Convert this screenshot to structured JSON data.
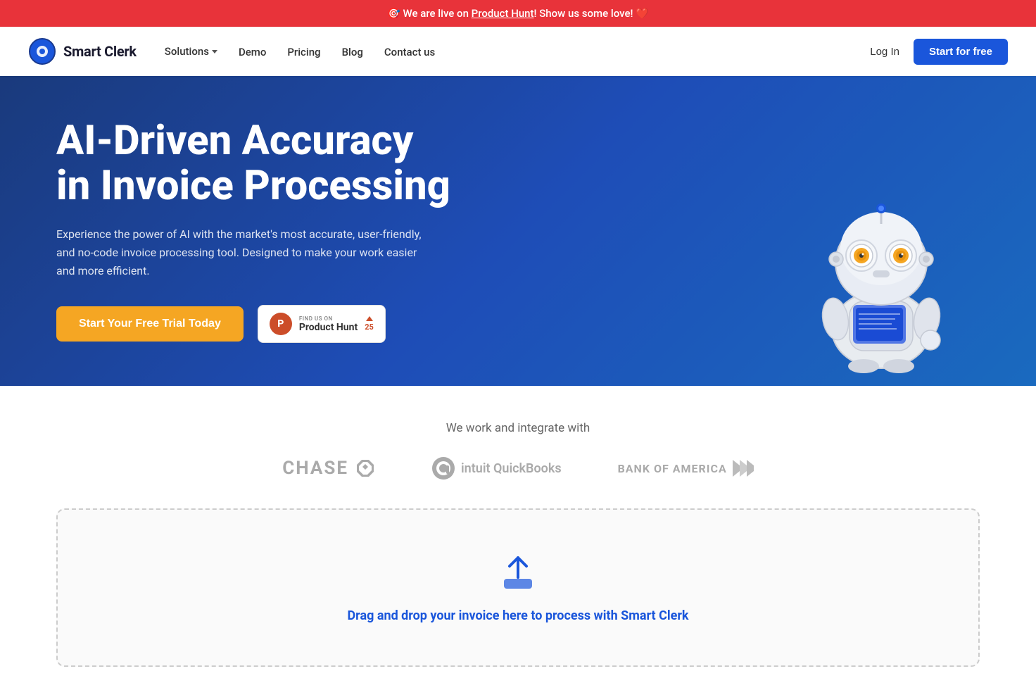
{
  "banner": {
    "text_before": "🎯 We are live on ",
    "link_text": "Product Hunt",
    "text_after": "! Show us some love! ❤️"
  },
  "navbar": {
    "logo_text": "Smart Clerk",
    "nav_items": [
      {
        "label": "Solutions",
        "has_dropdown": true
      },
      {
        "label": "Demo"
      },
      {
        "label": "Pricing"
      },
      {
        "label": "Blog"
      },
      {
        "label": "Contact us"
      }
    ],
    "login_label": "Log In",
    "start_free_label": "Start for free"
  },
  "hero": {
    "title_line1": "AI-Driven Accuracy",
    "title_line2": "in Invoice Processing",
    "subtitle": "Experience the power of AI with the market's most accurate, user-friendly, and no-code invoice processing tool. Designed to make your work easier and more efficient.",
    "cta_button": "Start Your Free Trial Today",
    "ph_find_text": "FIND US ON",
    "ph_name": "Product Hunt",
    "ph_score": "25"
  },
  "integration": {
    "title": "We work and integrate with",
    "logos": [
      {
        "name": "Chase"
      },
      {
        "name": "QuickBooks"
      },
      {
        "name": "Bank of America"
      }
    ]
  },
  "dropzone": {
    "text_before": "Drag and drop your invoice here to process with ",
    "brand": "Smart Clerk"
  },
  "icons": {
    "upload": "⬆",
    "ph_logo": "P"
  }
}
